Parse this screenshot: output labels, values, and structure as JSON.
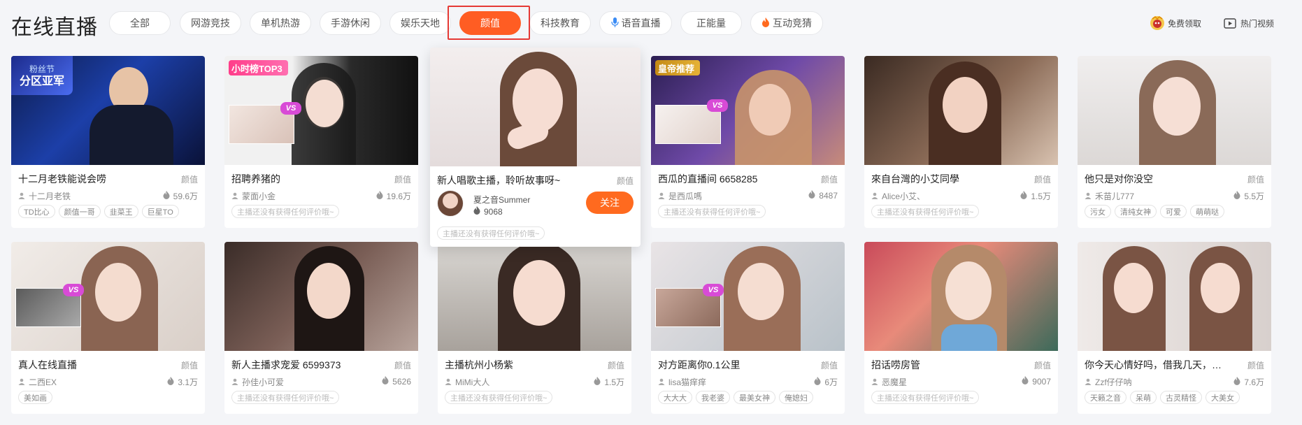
{
  "page_title": "在线直播",
  "tabs": [
    {
      "label": "全部",
      "active": false
    },
    {
      "label": "网游竞技",
      "active": false
    },
    {
      "label": "单机热游",
      "active": false
    },
    {
      "label": "手游休闲",
      "active": false
    },
    {
      "label": "娱乐天地",
      "active": false
    },
    {
      "label": "颜值",
      "active": true
    },
    {
      "label": "科技教育",
      "active": false
    },
    {
      "label": "语音直播",
      "active": false,
      "icon": "microphone-icon"
    },
    {
      "label": "正能量",
      "active": false
    },
    {
      "label": "互动竞猜",
      "active": false,
      "icon": "flame-icon"
    }
  ],
  "header_right": {
    "free_label": "免费领取",
    "free_icon": "gift-avatar-icon",
    "videos_label": "热门视频",
    "videos_icon": "video-play-icon"
  },
  "colors": {
    "accent": "#ff5d23",
    "highlight_box": "#e53935",
    "vs_badge": "#d84bd6"
  },
  "cards": [
    {
      "title": "十二月老铁能说会唠",
      "category": "颜值",
      "streamer": "十二月老铁",
      "viewers": "59.6万",
      "tags": [
        "TD比心",
        "颜值一哥",
        "韭菜王",
        "巨星TO"
      ],
      "badge": {
        "text": "分区亚军",
        "sub": "粉丝节",
        "style": "blue"
      }
    },
    {
      "title": "招聘养猪的",
      "category": "颜值",
      "streamer": "蒙面小金",
      "viewers": "19.6万",
      "tags": [
        "主播还没有获得任何评价哦~"
      ],
      "badge": {
        "text": "小时榜TOP3",
        "style": "pink"
      },
      "vs": true
    },
    {
      "title": "新人唱歌主播，聆听故事呀~",
      "category": "颜值",
      "streamer": "夏之音Summer",
      "viewers": "9068",
      "tags": [
        "主播还没有获得任何评价哦~"
      ],
      "follow_label": "关注",
      "hover": true
    },
    {
      "title": "西瓜的直播间 6658285",
      "category": "颜值",
      "streamer": "是西瓜嗎",
      "viewers": "8487",
      "tags": [
        "主播还没有获得任何评价哦~"
      ],
      "badge": {
        "text": "皇帝推荐",
        "style": "gold"
      },
      "vs": true
    },
    {
      "title": "來自台灣的小艾同學",
      "category": "颜值",
      "streamer": "Alice小艾、",
      "viewers": "1.5万",
      "tags": [
        "主播还没有获得任何评价哦~"
      ]
    },
    {
      "title": "他只是对你没空",
      "category": "颜值",
      "streamer": "禾苗儿777",
      "viewers": "5.5万",
      "tags": [
        "污女",
        "清纯女神",
        "可爱",
        "萌萌哒"
      ]
    },
    {
      "title": "真人在线直播",
      "category": "颜值",
      "streamer": "二西EX",
      "viewers": "3.1万",
      "tags": [
        "美如画"
      ],
      "vs": true
    },
    {
      "title": "新人主播求宠爱 6599373",
      "category": "颜值",
      "streamer": "孙佳小可爱",
      "viewers": "5626",
      "tags": [
        "主播还没有获得任何评价哦~"
      ]
    },
    {
      "title": "主播杭州小杨紫",
      "category": "颜值",
      "streamer": "MiMi大人",
      "viewers": "1.5万",
      "tags": [
        "主播还没有获得任何评价哦~"
      ]
    },
    {
      "title": "对方距离你0.1公里",
      "category": "颜值",
      "streamer": "lisa猫痒痒",
      "viewers": "6万",
      "tags": [
        "大大大",
        "我老婆",
        "最美女神",
        "俺媳妇"
      ],
      "vs": true
    },
    {
      "title": "招话唠房管",
      "category": "颜值",
      "streamer": "恶魔星",
      "viewers": "9007",
      "tags": [
        "主播还没有获得任何评价哦~"
      ]
    },
    {
      "title": "你今天心情好吗，借我几天，我...",
      "category": "颜值",
      "streamer": "Zzf仔仔呐",
      "viewers": "7.6万",
      "tags": [
        "天籁之音",
        "呆萌",
        "古灵精怪",
        "大美女"
      ]
    }
  ]
}
